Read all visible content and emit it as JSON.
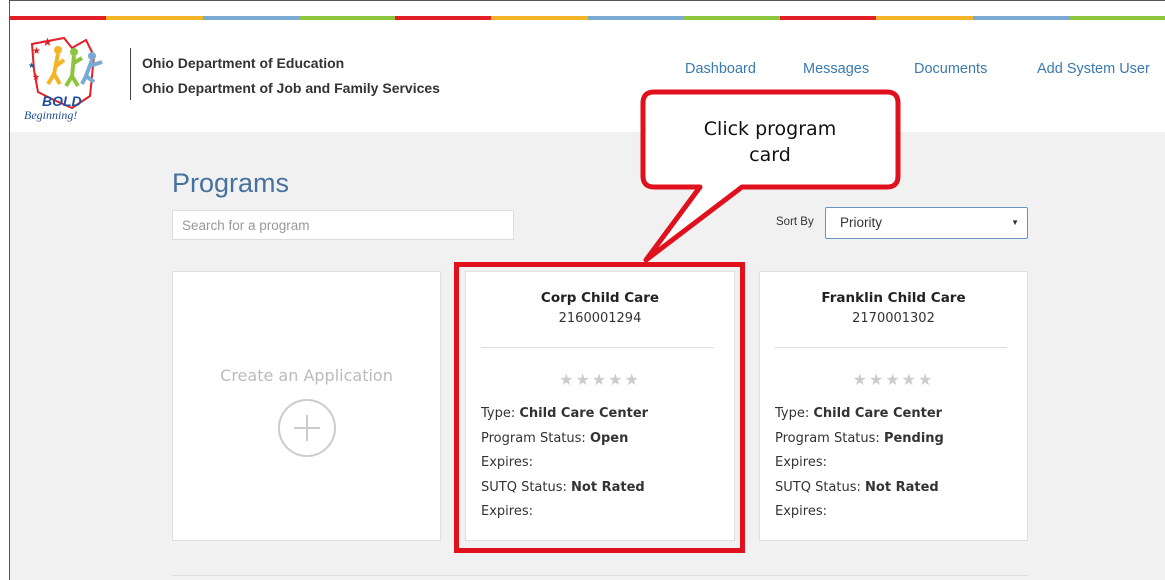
{
  "header": {
    "logo_text": "BOLD Beginning!",
    "dept_line1": "Ohio Department of Education",
    "dept_line2": "Ohio Department of Job and Family Services",
    "nav": [
      "Dashboard",
      "Messages",
      "Documents",
      "Add System User"
    ]
  },
  "colors": {
    "stripe": [
      "#e21f26",
      "#f3b527",
      "#7aa9d3",
      "#8cc63f",
      "#e21f26",
      "#f3b527",
      "#7aa9d3",
      "#8cc63f",
      "#e21f26",
      "#f3b527",
      "#7aa9d3",
      "#8cc63f"
    ],
    "accent": "#45729e",
    "highlight": "#e0101d"
  },
  "page": {
    "title": "Programs",
    "search_placeholder": "Search for a program",
    "sort_label": "Sort By",
    "sort_value": "Priority"
  },
  "create_card": {
    "label": "Create an Application",
    "icon": "plus-circle-icon"
  },
  "programs": [
    {
      "name": "Corp Child Care",
      "id": "2160001294",
      "stars": "★★★★★",
      "type_label": "Type:",
      "type": "Child Care Center",
      "status_label": "Program Status:",
      "status": "Open",
      "expires_label": "Expires:",
      "sutq_label": "SUTQ Status:",
      "sutq": "Not Rated",
      "expires2_label": "Expires:"
    },
    {
      "name": "Franklin Child Care",
      "id": "2170001302",
      "stars": "★★★★★",
      "type_label": "Type:",
      "type": "Child Care Center",
      "status_label": "Program Status:",
      "status": "Pending",
      "expires_label": "Expires:",
      "sutq_label": "SUTQ Status:",
      "sutq": "Not Rated",
      "expires2_label": "Expires:"
    }
  ],
  "callout": {
    "line1": "Click program",
    "line2": "card"
  }
}
